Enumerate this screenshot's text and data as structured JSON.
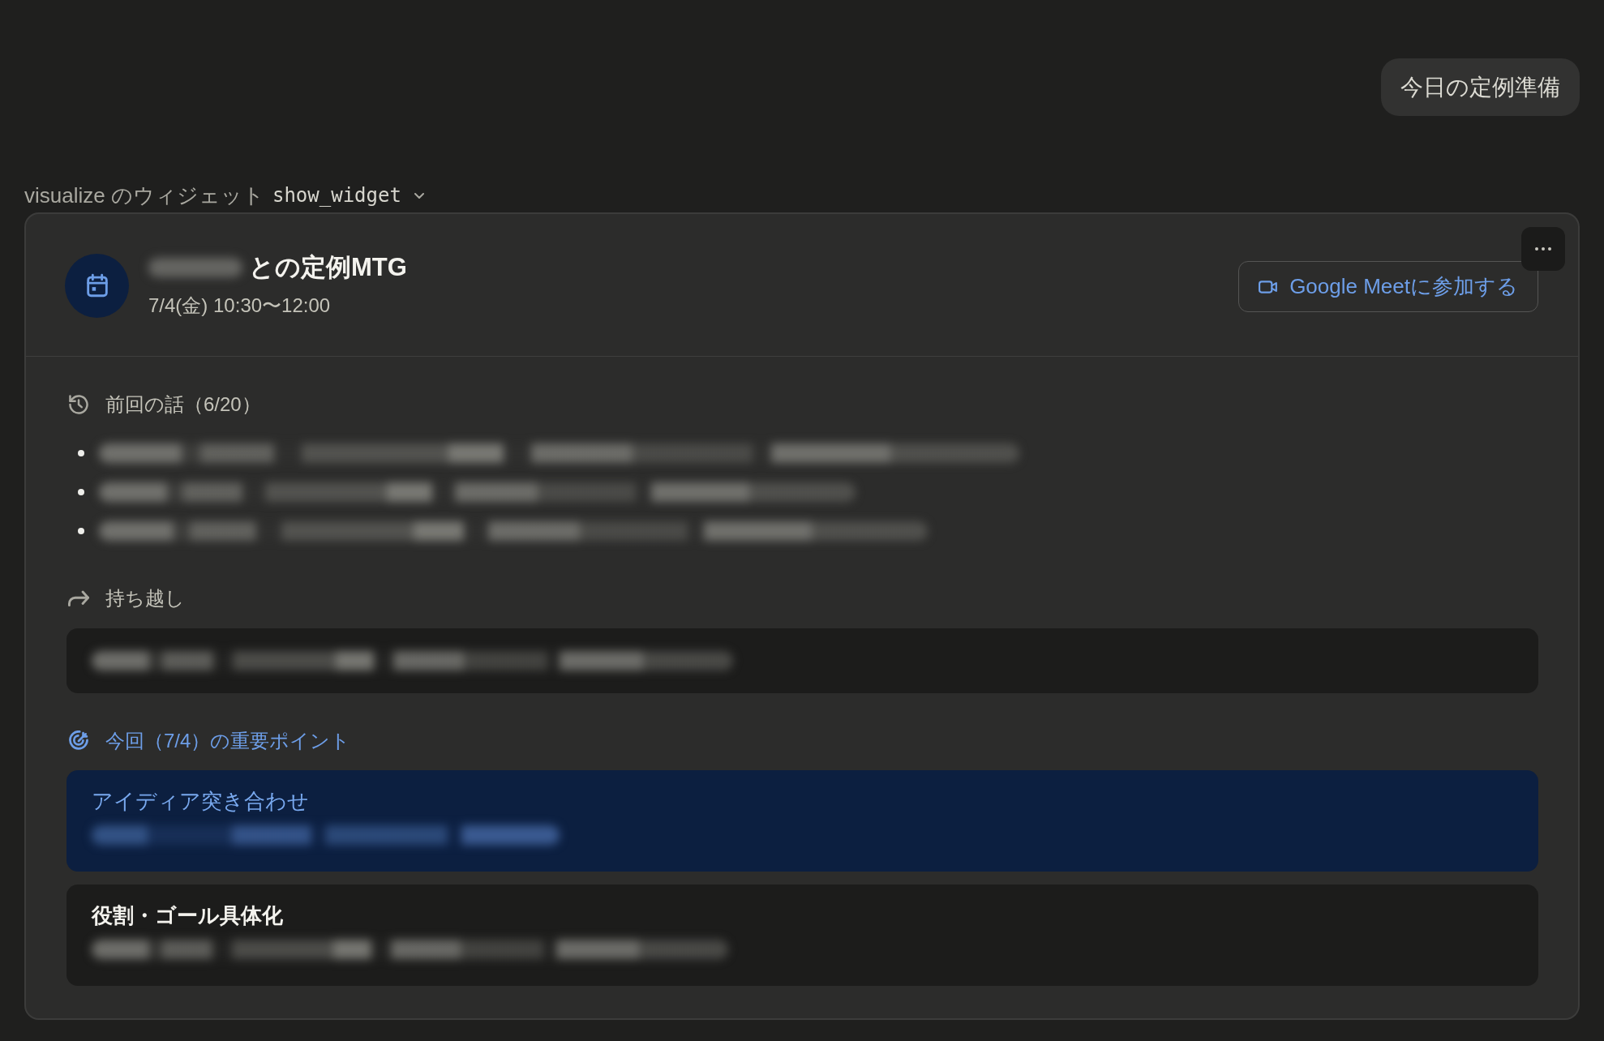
{
  "prompt_chip": {
    "label": "今日の定例準備"
  },
  "tool_call": {
    "label": "visualize のウィジェット",
    "tool_name": "show_widget"
  },
  "widget": {
    "header": {
      "title_prefix_redacted": true,
      "title": "との定例MTG",
      "datetime": "7/4(金) 10:30〜12:00",
      "join_button": {
        "label": "Google Meetに参加する"
      }
    },
    "sections": [
      {
        "kind": "bullets",
        "heading": "前回の話（6/20）",
        "items": [
          {
            "redacted": true
          },
          {
            "redacted": true
          },
          {
            "redacted": true
          }
        ]
      },
      {
        "kind": "note",
        "heading": "持ち越し",
        "redacted": true
      },
      {
        "kind": "points",
        "heading": "今回（7/4）の重要ポイント",
        "items": [
          {
            "title": "アイディア突き合わせ",
            "emphasized": true,
            "detail_redacted": true
          },
          {
            "title": "役割・ゴール具体化",
            "emphasized": false,
            "detail_redacted": true
          }
        ]
      }
    ]
  }
}
